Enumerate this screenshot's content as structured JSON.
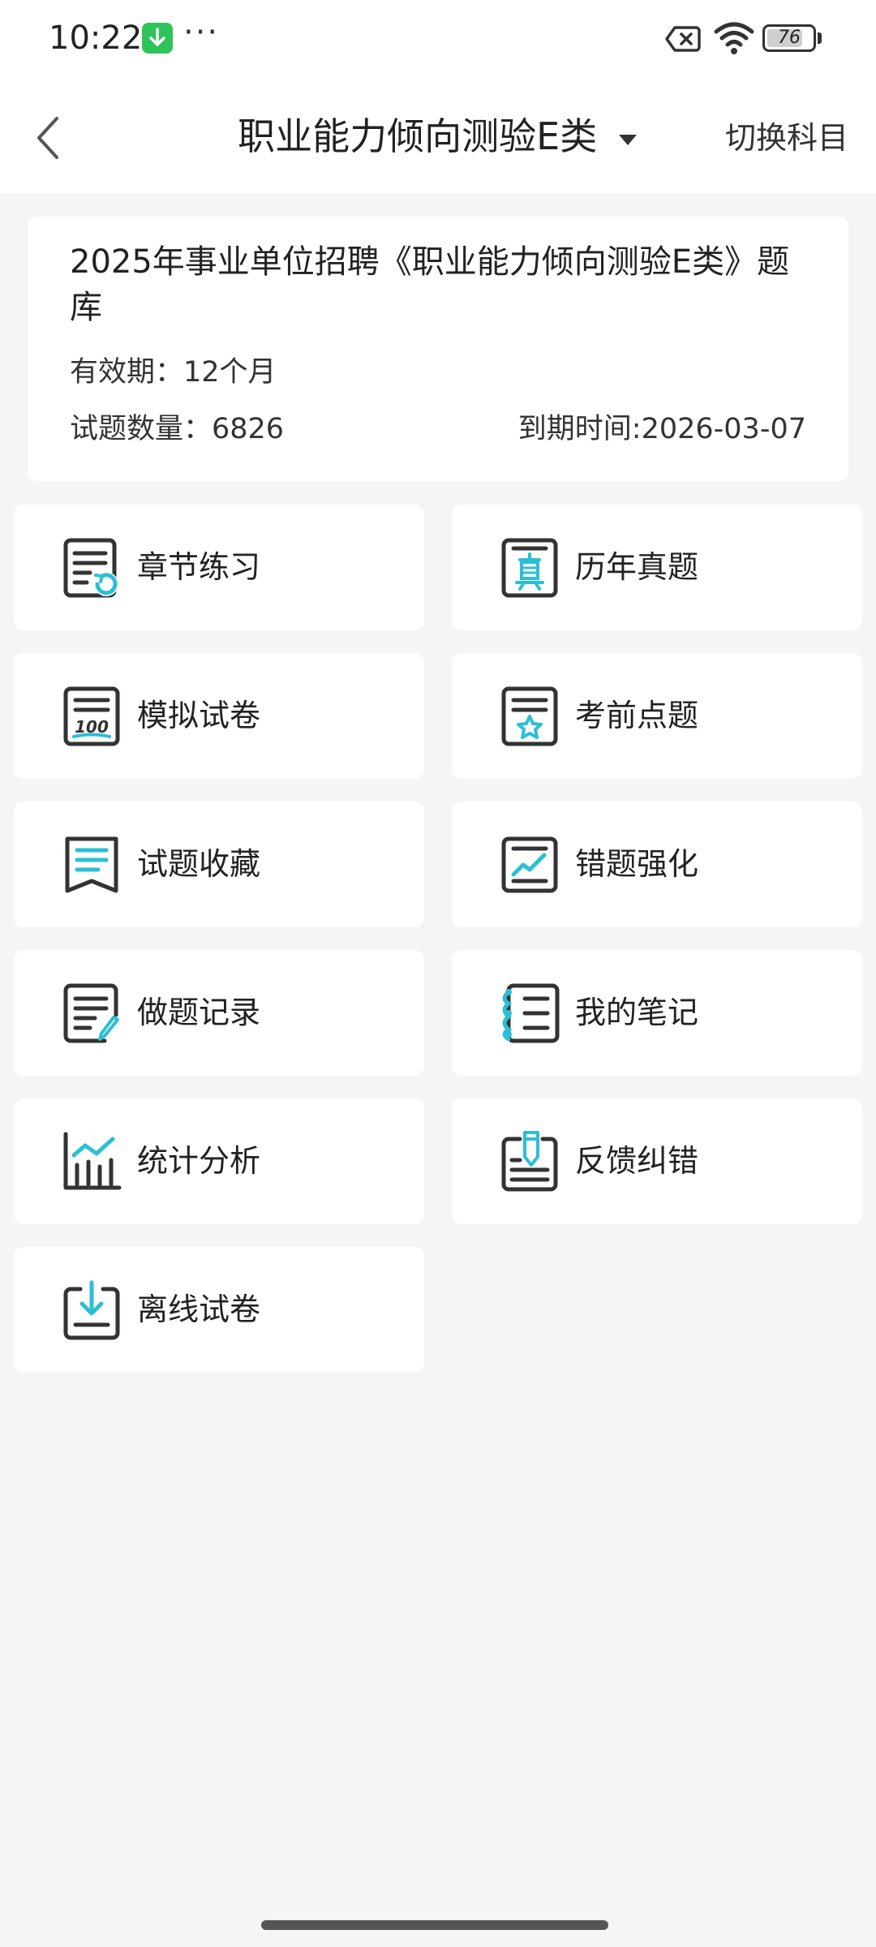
{
  "status_bar": {
    "time": "10:22",
    "more": "···",
    "battery": "76",
    "icons": [
      "download-notification-icon",
      "sim-blocked-icon",
      "wifi-icon",
      "battery-icon"
    ]
  },
  "nav": {
    "title": "职业能力倾向测验E类",
    "switch_label": "切换科目",
    "icons": [
      "back-arrow-icon",
      "dropdown-caret-icon"
    ]
  },
  "info": {
    "title": "2025年事业单位招聘《职业能力倾向测验E类》题库",
    "validity": "有效期：12个月",
    "count": "试题数量：6826",
    "expiry": "到期时间:2026-03-07"
  },
  "menu": [
    {
      "label": "章节练习",
      "icon": "chapter-practice-icon"
    },
    {
      "label": "历年真题",
      "icon": "past-exam-icon"
    },
    {
      "label": "模拟试卷",
      "icon": "mock-exam-icon"
    },
    {
      "label": "考前点题",
      "icon": "key-points-icon"
    },
    {
      "label": "试题收藏",
      "icon": "bookmark-icon"
    },
    {
      "label": "错题强化",
      "icon": "wrong-questions-icon"
    },
    {
      "label": "做题记录",
      "icon": "practice-record-icon"
    },
    {
      "label": "我的笔记",
      "icon": "notes-icon"
    },
    {
      "label": "统计分析",
      "icon": "statistics-icon"
    },
    {
      "label": "反馈纠错",
      "icon": "feedback-icon"
    },
    {
      "label": "离线试卷",
      "icon": "offline-download-icon"
    }
  ],
  "colors": {
    "accent": "#2bbfd6",
    "icon_dark": "#333333",
    "background": "#f5f5f5",
    "card": "#ffffff"
  }
}
